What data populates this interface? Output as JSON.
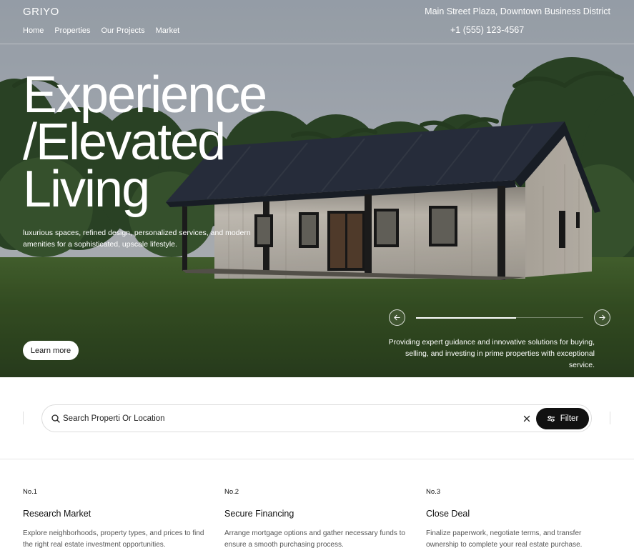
{
  "header": {
    "brand": "GRIYO",
    "nav": [
      "Home",
      "Properties",
      "Our Projects",
      "Market"
    ],
    "address": "Main Street Plaza, Downtown Business District",
    "phone": "+1 (555) 123-4567"
  },
  "hero": {
    "headline": [
      "Experience",
      "/Elevated",
      "Living"
    ],
    "tagline": "luxurious spaces, refined design, personalized services, and modern amenities for a sophisticated, upscale lifestyle.",
    "cta": "Learn more",
    "description": "Providing expert guidance and innovative solutions for buying, selling, and investing in prime properties with exceptional service.",
    "carousel_progress": 0.6
  },
  "search": {
    "placeholder": "Search Properti Or Location",
    "filter_label": "Filter"
  },
  "steps": [
    {
      "number": "No.1",
      "title": "Research Market",
      "description": "Explore neighborhoods, property types, and prices to find the right real estate investment opportunities."
    },
    {
      "number": "No.2",
      "title": "Secure Financing",
      "description": "Arrange mortgage options and gather necessary funds to ensure a smooth purchasing process."
    },
    {
      "number": "No.3",
      "title": "Close Deal",
      "description": "Finalize paperwork, negotiate terms, and transfer ownership to complete your real estate purchase."
    }
  ],
  "colors": {
    "primary": "#111111",
    "text_muted": "#555555",
    "border": "#dcdcdc",
    "on_dark": "#ffffff"
  },
  "icons": [
    "search-icon",
    "close-icon",
    "filter-icon",
    "arrow-left-icon",
    "arrow-right-icon"
  ]
}
